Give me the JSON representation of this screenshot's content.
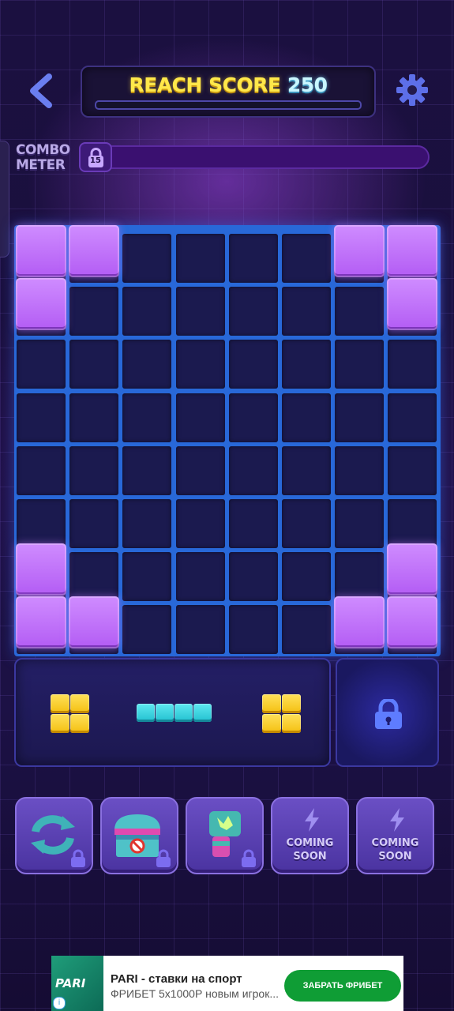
{
  "header": {
    "score_label": "REACH SCORE",
    "score_target": "250",
    "score_progress": 0
  },
  "combo": {
    "label_line1": "COMBO",
    "label_line2": "METER",
    "lock_level": "15",
    "progress": 0
  },
  "board": {
    "rows": 8,
    "cols": 8,
    "filled_cells": [
      [
        0,
        0
      ],
      [
        0,
        1
      ],
      [
        0,
        6
      ],
      [
        0,
        7
      ],
      [
        1,
        0
      ],
      [
        1,
        7
      ],
      [
        6,
        0
      ],
      [
        6,
        7
      ],
      [
        7,
        0
      ],
      [
        7,
        1
      ],
      [
        7,
        6
      ],
      [
        7,
        7
      ]
    ],
    "block_color": "#b35cf4"
  },
  "tray": {
    "pieces": [
      {
        "shape": "2x2 square",
        "color": "#f4bf10"
      },
      {
        "shape": "1x4 line",
        "color": "#22c0d0"
      },
      {
        "shape": "2x2 square",
        "color": "#f4bf10"
      }
    ],
    "locked_slot": true
  },
  "boosters": [
    {
      "icon": "swap-arrows-icon",
      "locked": true
    },
    {
      "icon": "treasure-chest-icon",
      "locked": true
    },
    {
      "icon": "smash-fist-icon",
      "locked": true
    },
    {
      "icon": "lightning-icon",
      "label_line1": "COMING",
      "label_line2": "SOON"
    },
    {
      "icon": "lightning-icon",
      "label_line1": "COMING",
      "label_line2": "SOON"
    }
  ],
  "ad": {
    "logo_text": "PARI",
    "title": "PARI - ставки на спорт",
    "subtitle": "ФРИБЕТ 5x1000Р новым игрок...",
    "button_label": "ЗАБРАТЬ ФРИБЕТ"
  }
}
